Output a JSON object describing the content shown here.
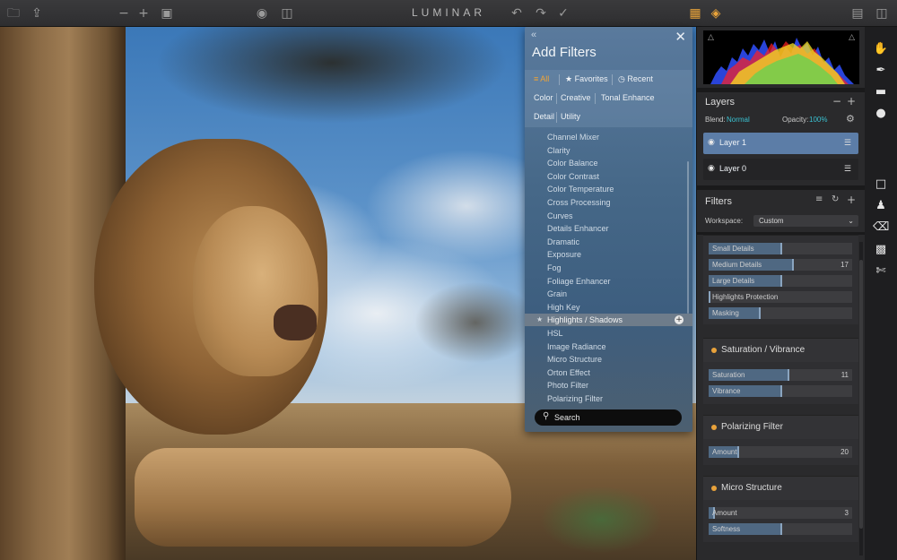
{
  "app": {
    "title": "LUMINAR"
  },
  "colors": {
    "accent": "#f0a435",
    "teal": "#3ac0d0",
    "selected_layer": "#5c7da7"
  },
  "toolbar": {
    "icons": [
      "folder-icon",
      "share-icon",
      "zoom-out-icon",
      "zoom-in-icon",
      "fit-icon",
      "eye-icon",
      "compare-icon",
      "undo-icon",
      "redo-icon",
      "history-icon",
      "image-icon",
      "layers-icon",
      "layout-icon",
      "panel-icon"
    ]
  },
  "add_filters": {
    "title": "Add Filters",
    "tabs": [
      {
        "label": "All",
        "active": true
      },
      {
        "label": "Favorites",
        "active": false
      },
      {
        "label": "Recent",
        "active": false
      }
    ],
    "categories": [
      "Color",
      "Creative",
      "Tonal Enhance",
      "Detail",
      "Utility"
    ],
    "filters": [
      {
        "label": "Channel Mixer"
      },
      {
        "label": "Clarity"
      },
      {
        "label": "Color Balance"
      },
      {
        "label": "Color Contrast"
      },
      {
        "label": "Color Temperature"
      },
      {
        "label": "Cross Processing"
      },
      {
        "label": "Curves"
      },
      {
        "label": "Details Enhancer"
      },
      {
        "label": "Dramatic"
      },
      {
        "label": "Exposure"
      },
      {
        "label": "Fog"
      },
      {
        "label": "Foliage Enhancer"
      },
      {
        "label": "Grain"
      },
      {
        "label": "High Key"
      },
      {
        "label": "Highlights / Shadows",
        "selected": true
      },
      {
        "label": "HSL"
      },
      {
        "label": "Image Radiance"
      },
      {
        "label": "Micro Structure"
      },
      {
        "label": "Orton Effect"
      },
      {
        "label": "Photo Filter"
      },
      {
        "label": "Polarizing Filter"
      }
    ],
    "search": {
      "placeholder": "Search",
      "value": ""
    }
  },
  "layers": {
    "title": "Layers",
    "blend_label": "Blend:",
    "blend_value": "Normal",
    "opacity_label": "Opacity:",
    "opacity_value": "100%",
    "items": [
      {
        "name": "Layer 1",
        "active": true
      },
      {
        "name": "Layer 0",
        "active": false
      }
    ]
  },
  "filters_panel": {
    "title": "Filters",
    "workspace_label": "Workspace:",
    "workspace_value": "Custom",
    "detail_sliders": [
      {
        "label": "Small Details",
        "value": "",
        "level": 0.5
      },
      {
        "label": "Medium Details",
        "value": "17",
        "level": 0.58
      },
      {
        "label": "Large Details",
        "value": "",
        "level": 0.5
      },
      {
        "label": "Highlights Protection",
        "value": "",
        "level": 0.0
      },
      {
        "label": "Masking",
        "value": "",
        "level": 0.35
      }
    ],
    "blocks": [
      {
        "title": "Saturation / Vibrance",
        "sliders": [
          {
            "label": "Saturation",
            "value": "11",
            "level": 0.55
          },
          {
            "label": "Vibrance",
            "value": "",
            "level": 0.5
          }
        ]
      },
      {
        "title": "Polarizing Filter",
        "sliders": [
          {
            "label": "Amount",
            "value": "20",
            "level": 0.2
          }
        ]
      },
      {
        "title": "Micro Structure",
        "sliders": [
          {
            "label": "Amount",
            "value": "3",
            "level": 0.03
          },
          {
            "label": "Softness",
            "value": "",
            "level": 0.5
          }
        ]
      }
    ]
  },
  "tools": [
    "hand-icon",
    "brush-icon",
    "gradient-icon",
    "radial-icon",
    "crop-icon",
    "clone-stamp-icon",
    "eraser-icon",
    "noise-icon",
    "cut-icon"
  ]
}
